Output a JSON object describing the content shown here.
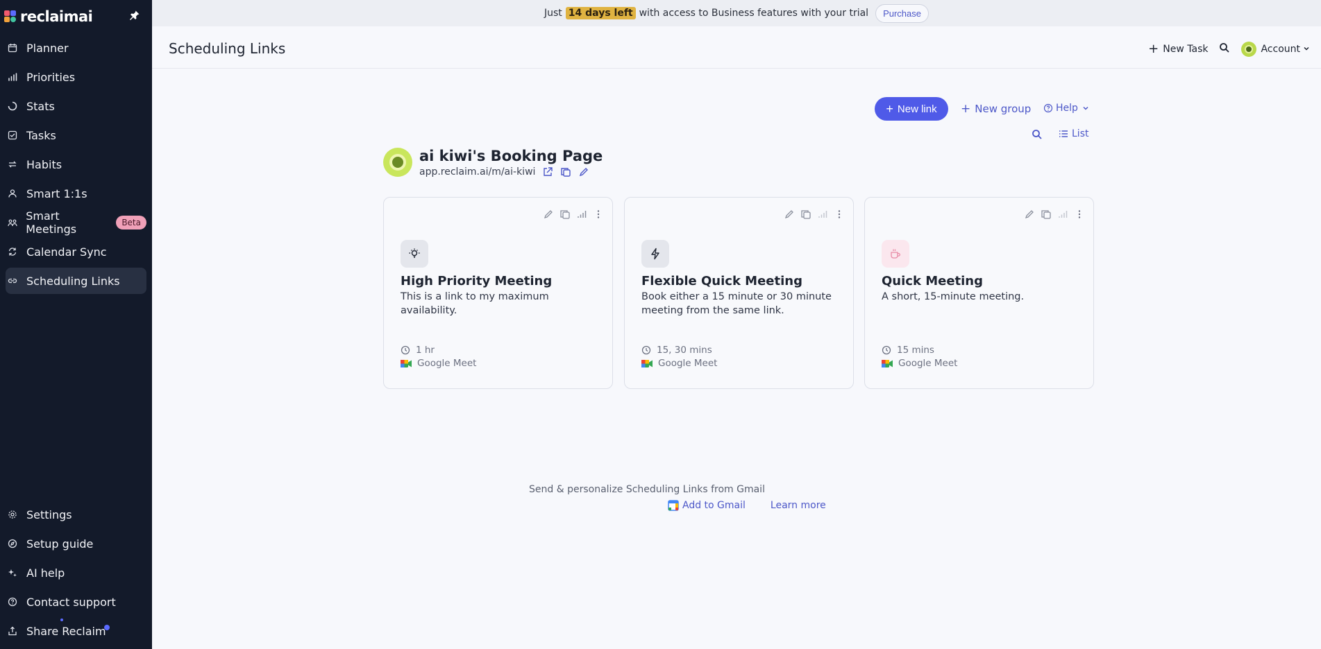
{
  "sidebar": {
    "brand": "reclaimai",
    "nav": [
      {
        "label": "Planner",
        "icon": "calendar-icon"
      },
      {
        "label": "Priorities",
        "icon": "bar-chart-icon"
      },
      {
        "label": "Stats",
        "icon": "ring-icon"
      },
      {
        "label": "Tasks",
        "icon": "checkbox-icon"
      },
      {
        "label": "Habits",
        "icon": "repeat-icon"
      },
      {
        "label": "Smart 1:1s",
        "icon": "people-icon"
      },
      {
        "label": "Smart Meetings",
        "icon": "group-icon",
        "badge": "Beta"
      },
      {
        "label": "Calendar Sync",
        "icon": "sync-icon"
      },
      {
        "label": "Scheduling Links",
        "icon": "link-icon",
        "active": true
      }
    ],
    "bottom": [
      {
        "label": "Settings",
        "icon": "gear-icon"
      },
      {
        "label": "Setup guide",
        "icon": "compass-icon"
      },
      {
        "label": "AI help",
        "icon": "sparkle-icon"
      },
      {
        "label": "Contact support",
        "icon": "help-circle-icon"
      },
      {
        "label": "Share Reclaim",
        "icon": "share-icon"
      }
    ]
  },
  "banner": {
    "pre": "Just",
    "highlight": "14 days left",
    "post": "with access to Business features with your trial",
    "button": "Purchase"
  },
  "header": {
    "title": "Scheduling Links",
    "new_task": "New Task",
    "account": "Account"
  },
  "toolbar": {
    "new_link": "New link",
    "new_group": "New group",
    "help": "Help",
    "list": "List"
  },
  "booking": {
    "title": "ai kiwi's Booking Page",
    "url": "app.reclaim.ai/m/ai-kiwi"
  },
  "cards": [
    {
      "title": "High Priority Meeting",
      "description": "This is a link to my maximum availability.",
      "duration": "1 hr",
      "platform": "Google Meet",
      "icon": "lightbulb-icon",
      "icon_bg": "#e4e6ec"
    },
    {
      "title": "Flexible Quick Meeting",
      "description": "Book either a 15 minute or 30 minute meeting from the same link.",
      "duration": "15, 30 mins",
      "platform": "Google Meet",
      "icon": "lightning-icon",
      "icon_bg": "#e4e6ec"
    },
    {
      "title": "Quick Meeting",
      "description": "A short, 15-minute meeting.",
      "duration": "15 mins",
      "platform": "Google Meet",
      "icon": "coffee-icon",
      "icon_bg": "#fbe7ee"
    }
  ],
  "promo": {
    "text": "Send & personalize Scheduling Links from Gmail",
    "add_to_gmail": "Add to Gmail",
    "learn_more": "Learn more"
  },
  "colors": {
    "sidebar_bg": "#131a2a",
    "accent": "#4f5ae8",
    "trial_highlight": "#e0b341",
    "beta_badge": "#f0a0b8"
  }
}
